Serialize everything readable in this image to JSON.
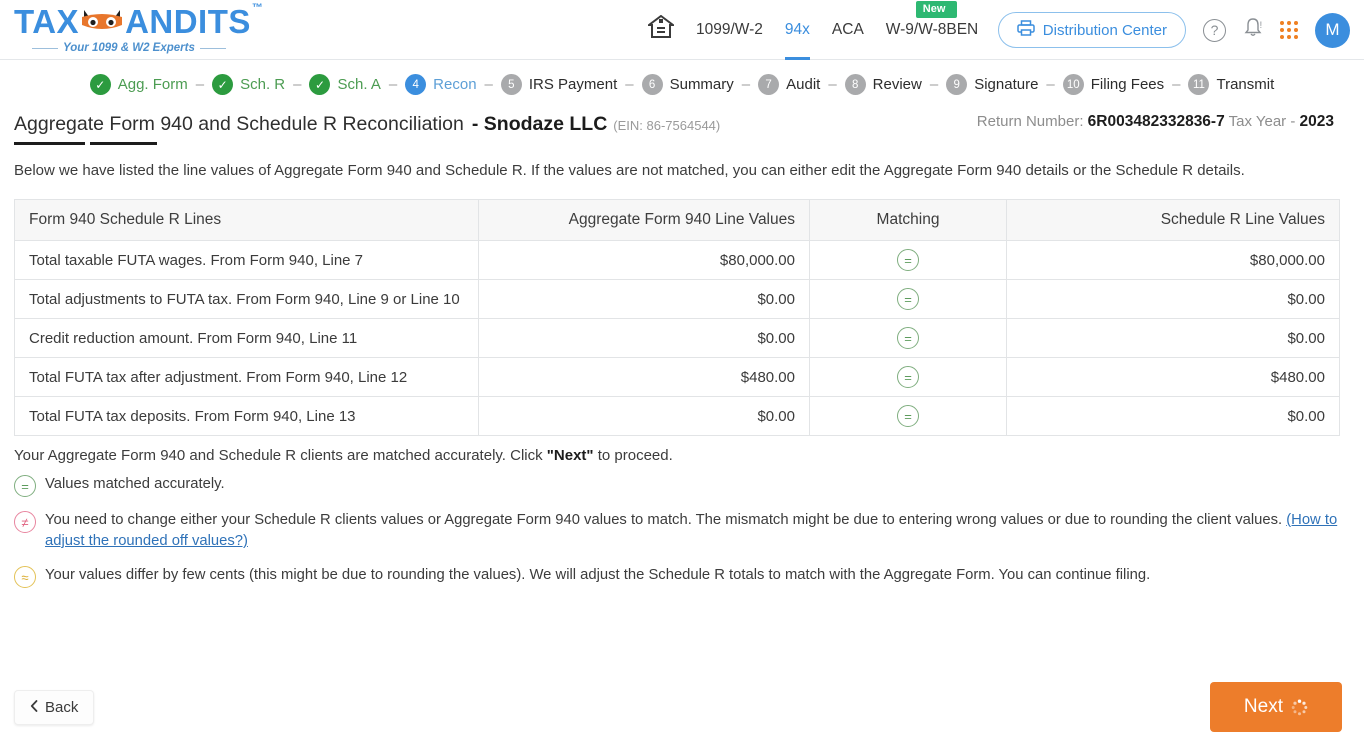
{
  "header": {
    "logo": {
      "text_main": "TAX",
      "text_mask": "",
      "text_rest": "ANDITS",
      "tm": "™",
      "tagline": "Your 1099 & W2 Experts"
    },
    "nav": [
      {
        "label": "1099/W-2",
        "active": false,
        "badge": ""
      },
      {
        "label": "94x",
        "active": true,
        "badge": ""
      },
      {
        "label": "ACA",
        "active": false,
        "badge": ""
      },
      {
        "label": "W-9/W-8BEN",
        "active": false,
        "badge": "New"
      }
    ],
    "home_icon": "home-icon",
    "distribution_center": "Distribution Center",
    "help_icon": "?",
    "bell_icon": "notification-bell-icon",
    "apps_icon": "apps-grid-icon",
    "avatar_initial": "M"
  },
  "stepper": {
    "separator": "–",
    "steps": [
      {
        "num": "✓",
        "label": "Agg. Form",
        "state": "done"
      },
      {
        "num": "✓",
        "label": "Sch. R",
        "state": "done"
      },
      {
        "num": "✓",
        "label": "Sch. A",
        "state": "done"
      },
      {
        "num": "4",
        "label": "Recon",
        "state": "active"
      },
      {
        "num": "5",
        "label": "IRS Payment",
        "state": "todo"
      },
      {
        "num": "6",
        "label": "Summary",
        "state": "todo"
      },
      {
        "num": "7",
        "label": "Audit",
        "state": "todo"
      },
      {
        "num": "8",
        "label": "Review",
        "state": "todo"
      },
      {
        "num": "9",
        "label": "Signature",
        "state": "todo"
      },
      {
        "num": "10",
        "label": "Filing Fees",
        "state": "todo"
      },
      {
        "num": "11",
        "label": "Transmit",
        "state": "todo"
      }
    ]
  },
  "page": {
    "title": "Aggregate Form 940 and Schedule R Reconciliation",
    "company": "- Snodaze LLC",
    "ein": "(EIN: 86-7564544)",
    "return_number_label": "Return Number:",
    "return_number": "6R003482332836-7",
    "tax_year_label": "Tax Year -",
    "tax_year": "2023",
    "intro": "Below we have listed the line values of Aggregate Form 940 and Schedule R. If the values are not matched, you can either edit the Aggregate Form 940 details or the Schedule R details."
  },
  "table": {
    "columns": [
      "Form 940 Schedule R Lines",
      "Aggregate Form 940 Line Values",
      "Matching",
      "Schedule R Line Values"
    ],
    "rows": [
      {
        "line": "Total taxable FUTA wages. From Form 940, Line 7",
        "agg": "$80,000.00",
        "match": "=",
        "sched": "$80,000.00"
      },
      {
        "line": "Total adjustments to FUTA tax. From Form 940, Line 9 or Line 10",
        "agg": "$0.00",
        "match": "=",
        "sched": "$0.00"
      },
      {
        "line": "Credit reduction amount. From Form 940, Line 11",
        "agg": "$0.00",
        "match": "=",
        "sched": "$0.00"
      },
      {
        "line": "Total FUTA tax after adjustment. From Form 940, Line 12",
        "agg": "$480.00",
        "match": "=",
        "sched": "$480.00"
      },
      {
        "line": "Total FUTA tax deposits. From Form 940, Line 13",
        "agg": "$0.00",
        "match": "=",
        "sched": "$0.00"
      }
    ]
  },
  "confirmation": {
    "prefix": "Your Aggregate Form 940 and Schedule R clients are matched accurately. Click ",
    "bold": "\"Next\"",
    "suffix": " to proceed."
  },
  "legend": [
    {
      "icon": "=",
      "style": "eq",
      "text": "Values matched accurately.",
      "link": ""
    },
    {
      "icon": "≠",
      "style": "neq",
      "text": "You need to change either your Schedule R clients values or Aggregate Form 940 values to match. The mismatch might be due to entering wrong values or due to rounding the client values. ",
      "link": "(How to adjust the rounded off values?)"
    },
    {
      "icon": "≈",
      "style": "approx",
      "text": "Your values differ by few cents (this might be due to rounding the values). We will adjust the Schedule R totals to match with the Aggregate Form. You can continue filing.",
      "link": ""
    }
  ],
  "footer": {
    "back_label": "Back",
    "back_icon": "chevron-left-icon",
    "next_label": "Next",
    "next_icon": "loading-spinner-icon"
  },
  "colors": {
    "brand_blue": "#3b8ede",
    "accent_orange": "#ed7d2b",
    "success_green": "#2c9b3f",
    "badge_green": "#2eb872",
    "mismatch_pink": "#e0607f",
    "approx_yellow": "#d9ab2b"
  }
}
